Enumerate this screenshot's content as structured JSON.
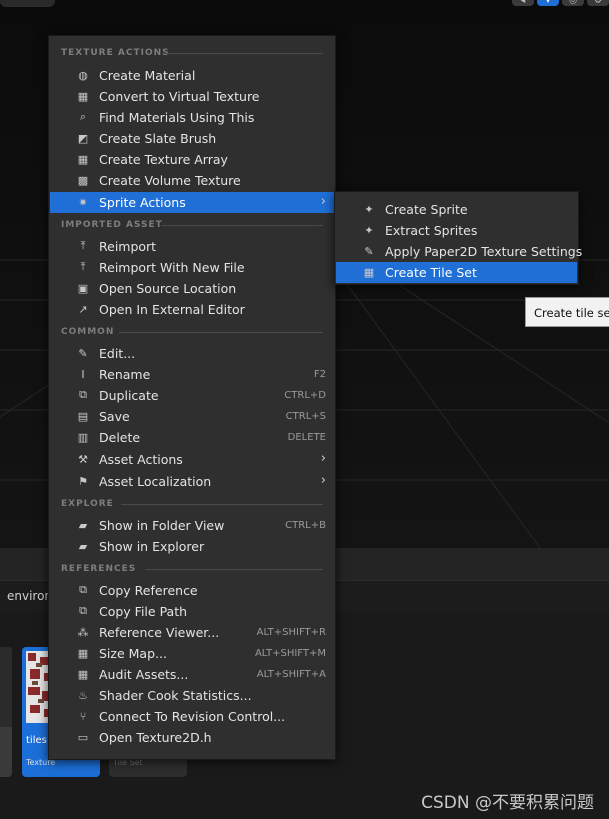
{
  "menu": {
    "sections": {
      "texture_actions": "TEXTURE ACTIONS",
      "imported_asset": "IMPORTED ASSET",
      "common": "COMMON",
      "explore": "EXPLORE",
      "references": "REFERENCES"
    },
    "items": [
      {
        "label": "Create Material",
        "icon": "material-icon",
        "shortcut": ""
      },
      {
        "label": "Convert to Virtual Texture",
        "icon": "checker-icon",
        "shortcut": ""
      },
      {
        "label": "Find Materials Using This",
        "icon": "search-icon",
        "shortcut": ""
      },
      {
        "label": "Create Slate Brush",
        "icon": "brush-icon",
        "shortcut": ""
      },
      {
        "label": "Create Texture Array",
        "icon": "checker-icon",
        "shortcut": ""
      },
      {
        "label": "Create Volume Texture",
        "icon": "volume-icon",
        "shortcut": ""
      },
      {
        "label": "Sprite Actions",
        "icon": "sprite-icon",
        "shortcut": ""
      },
      {
        "label": "Reimport",
        "icon": "reimport-icon",
        "shortcut": ""
      },
      {
        "label": "Reimport With New File",
        "icon": "reimport-icon",
        "shortcut": ""
      },
      {
        "label": "Open Source Location",
        "icon": "folder-open-icon",
        "shortcut": ""
      },
      {
        "label": "Open In External Editor",
        "icon": "external-icon",
        "shortcut": ""
      },
      {
        "label": "Edit...",
        "icon": "edit-icon",
        "shortcut": ""
      },
      {
        "label": "Rename",
        "icon": "rename-icon",
        "shortcut": "F2"
      },
      {
        "label": "Duplicate",
        "icon": "duplicate-icon",
        "shortcut": "CTRL+D"
      },
      {
        "label": "Save",
        "icon": "save-icon",
        "shortcut": "CTRL+S"
      },
      {
        "label": "Delete",
        "icon": "delete-icon",
        "shortcut": "DELETE"
      },
      {
        "label": "Asset Actions",
        "icon": "wrench-icon",
        "shortcut": ""
      },
      {
        "label": "Asset Localization",
        "icon": "flag-icon",
        "shortcut": ""
      },
      {
        "label": "Show in Folder View",
        "icon": "folder-icon",
        "shortcut": "CTRL+B"
      },
      {
        "label": "Show in Explorer",
        "icon": "folder-icon",
        "shortcut": ""
      },
      {
        "label": "Copy Reference",
        "icon": "copy-icon",
        "shortcut": ""
      },
      {
        "label": "Copy File Path",
        "icon": "copy-icon",
        "shortcut": ""
      },
      {
        "label": "Reference Viewer...",
        "icon": "reference-viewer-icon",
        "shortcut": "ALT+SHIFT+R"
      },
      {
        "label": "Size Map...",
        "icon": "size-map-icon",
        "shortcut": "ALT+SHIFT+M"
      },
      {
        "label": "Audit Assets...",
        "icon": "audit-icon",
        "shortcut": "ALT+SHIFT+A"
      },
      {
        "label": "Shader Cook Statistics...",
        "icon": "shader-icon",
        "shortcut": ""
      },
      {
        "label": "Connect To Revision Control...",
        "icon": "revision-control-icon",
        "shortcut": ""
      },
      {
        "label": "Open Texture2D.h",
        "icon": "cpp-file-icon",
        "shortcut": ""
      }
    ]
  },
  "submenu": {
    "items": [
      {
        "label": "Create Sprite",
        "icon": "sprite-create-icon"
      },
      {
        "label": "Extract Sprites",
        "icon": "sprite-extract-icon"
      },
      {
        "label": "Apply Paper2D Texture Settings",
        "icon": "paper2d-settings-icon"
      },
      {
        "label": "Create Tile Set",
        "icon": "tile-set-icon"
      }
    ]
  },
  "tooltip": "Create tile set",
  "content_browser": {
    "path_text": "environ",
    "tiles": [
      {
        "name": "tiles",
        "type": "Texture"
      },
      {
        "name": "",
        "type": "Tile Set"
      }
    ]
  },
  "watermark": "CSDN @不要积累问题",
  "colors": {
    "highlight": "#1f6fd6",
    "menu_bg": "#2f2f2f"
  }
}
